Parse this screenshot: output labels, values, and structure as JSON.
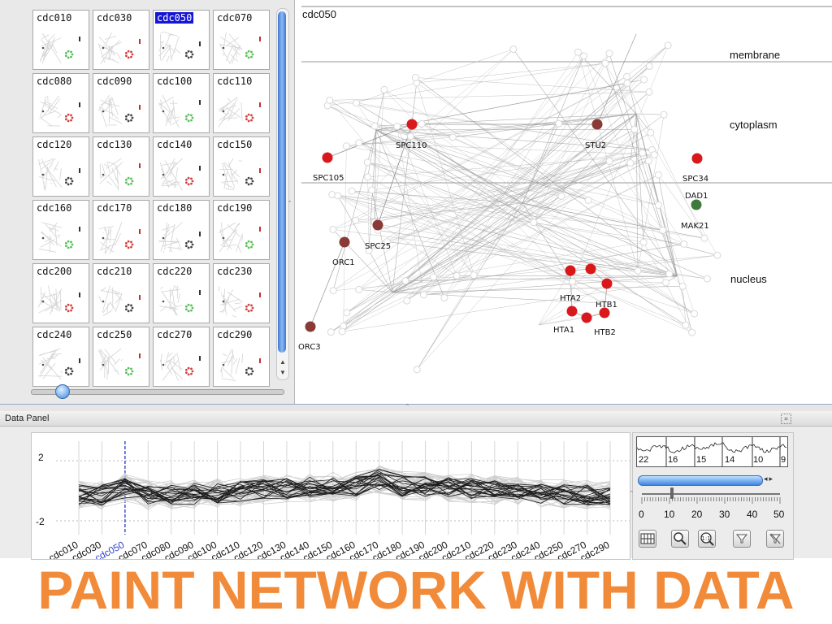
{
  "thumbnails": {
    "items": [
      {
        "label": "cdc010"
      },
      {
        "label": "cdc030"
      },
      {
        "label": "cdc050",
        "selected": true
      },
      {
        "label": "cdc070"
      },
      {
        "label": "cdc080"
      },
      {
        "label": "cdc090"
      },
      {
        "label": "cdc100"
      },
      {
        "label": "cdc110"
      },
      {
        "label": "cdc120"
      },
      {
        "label": "cdc130"
      },
      {
        "label": "cdc140"
      },
      {
        "label": "cdc150"
      },
      {
        "label": "cdc160"
      },
      {
        "label": "cdc170"
      },
      {
        "label": "cdc180"
      },
      {
        "label": "cdc190"
      },
      {
        "label": "cdc200"
      },
      {
        "label": "cdc210"
      },
      {
        "label": "cdc220"
      },
      {
        "label": "cdc230"
      },
      {
        "label": "cdc240"
      },
      {
        "label": "cdc250"
      },
      {
        "label": "cdc270"
      },
      {
        "label": "cdc290"
      }
    ],
    "selected_color": "#1515d6"
  },
  "network": {
    "title": "cdc050",
    "regions": [
      "membrane",
      "cytoplasm",
      "nucleus"
    ],
    "nodes": [
      {
        "label": "SPC110",
        "color": "#d9181c"
      },
      {
        "label": "SPC105",
        "color": "#d9181c"
      },
      {
        "label": "SPC25",
        "color": "#8a3a36"
      },
      {
        "label": "ORC1",
        "color": "#8a3a36"
      },
      {
        "label": "ORC3",
        "color": "#8a3a36"
      },
      {
        "label": "STU2",
        "color": "#8a3a36"
      },
      {
        "label": "SPC34",
        "color": "#d9181c"
      },
      {
        "label": "DAD1",
        "color": "#3f7a3a"
      },
      {
        "label": "MAK21",
        "color": null
      },
      {
        "label": "HTA2",
        "color": "#d9181c"
      },
      {
        "label": "HTB1",
        "color": "#d9181c"
      },
      {
        "label": "HTA1",
        "color": "#d9181c"
      },
      {
        "label": "HTB2",
        "color": "#d9181c"
      }
    ]
  },
  "data_panel": {
    "title": "Data Panel",
    "y_labels": [
      "2",
      "-2"
    ],
    "x_categories": [
      "cdc010",
      "cdc030",
      "cdc050",
      "cdc070",
      "cdc080",
      "cdc090",
      "cdc100",
      "cdc110",
      "cdc120",
      "cdc130",
      "cdc140",
      "cdc150",
      "cdc160",
      "cdc170",
      "cdc180",
      "cdc190",
      "cdc200",
      "cdc210",
      "cdc220",
      "cdc230",
      "cdc240",
      "cdc250",
      "cdc270",
      "cdc290"
    ],
    "selected_category": "cdc050",
    "selected_color": "#3344cc",
    "overview_labels": [
      "22",
      "16",
      "15",
      "14",
      "10",
      "9"
    ],
    "range_labels": [
      "0",
      "10",
      "20",
      "30",
      "40",
      "50"
    ],
    "range_value": 10,
    "tool_icons": [
      "heatmap-icon",
      "zoom-in-icon",
      "zoom-fit-icon",
      "filter-icon",
      "clear-filter-icon"
    ]
  },
  "caption": "PAINT NETWORK WITH DATA",
  "colors": {
    "caption": "#f18b3a",
    "scroll": "#3d78d0"
  }
}
